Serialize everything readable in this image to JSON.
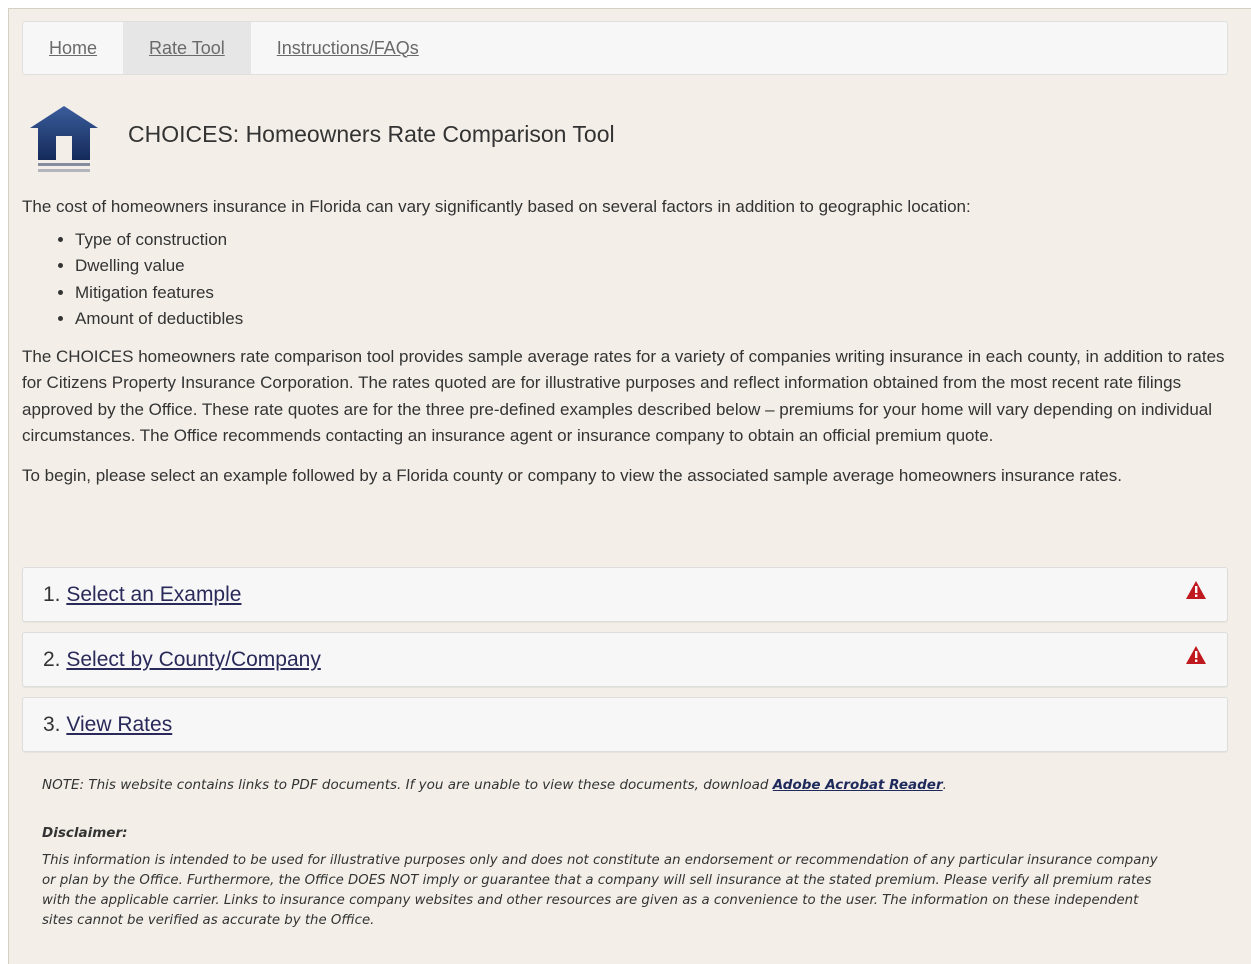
{
  "nav": {
    "items": [
      {
        "label": "Home"
      },
      {
        "label": "Rate Tool"
      },
      {
        "label": "Instructions/FAQs"
      }
    ]
  },
  "header": {
    "icon": "house-icon",
    "title": "CHOICES: Homeowners Rate Comparison Tool"
  },
  "intro": {
    "lead": "The cost of homeowners insurance in Florida can vary significantly based on several factors in addition to geographic location:",
    "factors": [
      "Type of construction",
      "Dwelling value",
      "Mitigation features",
      "Amount of deductibles"
    ],
    "description": "The CHOICES homeowners rate comparison tool provides sample average rates for a variety of companies writing insurance in each county, in addition to rates for Citizens Property Insurance Corporation. The rates quoted are for illustrative purposes and reflect information obtained from the most recent rate filings approved by the Office. These rate quotes are for the three pre-defined examples described below – premiums for your home will vary depending on individual circumstances. The Office recommends contacting an insurance agent or insurance company to obtain an official premium quote.",
    "begin": "To begin, please select an example followed by a Florida county or company to view the associated sample average homeowners insurance rates."
  },
  "steps": [
    {
      "number": "1.",
      "label": "Select an Example",
      "warning": true
    },
    {
      "number": "2.",
      "label": "Select by County/Company",
      "warning": true
    },
    {
      "number": "3.",
      "label": "View Rates",
      "warning": false
    }
  ],
  "colors": {
    "warning": "#c0181f",
    "background": "#f3efe8",
    "house": "#1f3a73"
  },
  "note": {
    "text": "NOTE: This website contains links to PDF documents. If you are unable to view these documents, download ",
    "link": "Adobe Acrobat Reader",
    "end": "."
  },
  "disclaimer": {
    "heading": "Disclaimer:",
    "text": "This information is intended to be used for illustrative purposes only and does not constitute an endorsement or recommendation of any particular insurance company or plan by the Office. Furthermore, the Office DOES NOT imply or guarantee that a company will sell insurance at the stated premium. Please verify all premium rates with the applicable carrier. Links to insurance company websites and other resources are given as a convenience to the user. The information on these independent sites cannot be verified as accurate by the Office."
  }
}
